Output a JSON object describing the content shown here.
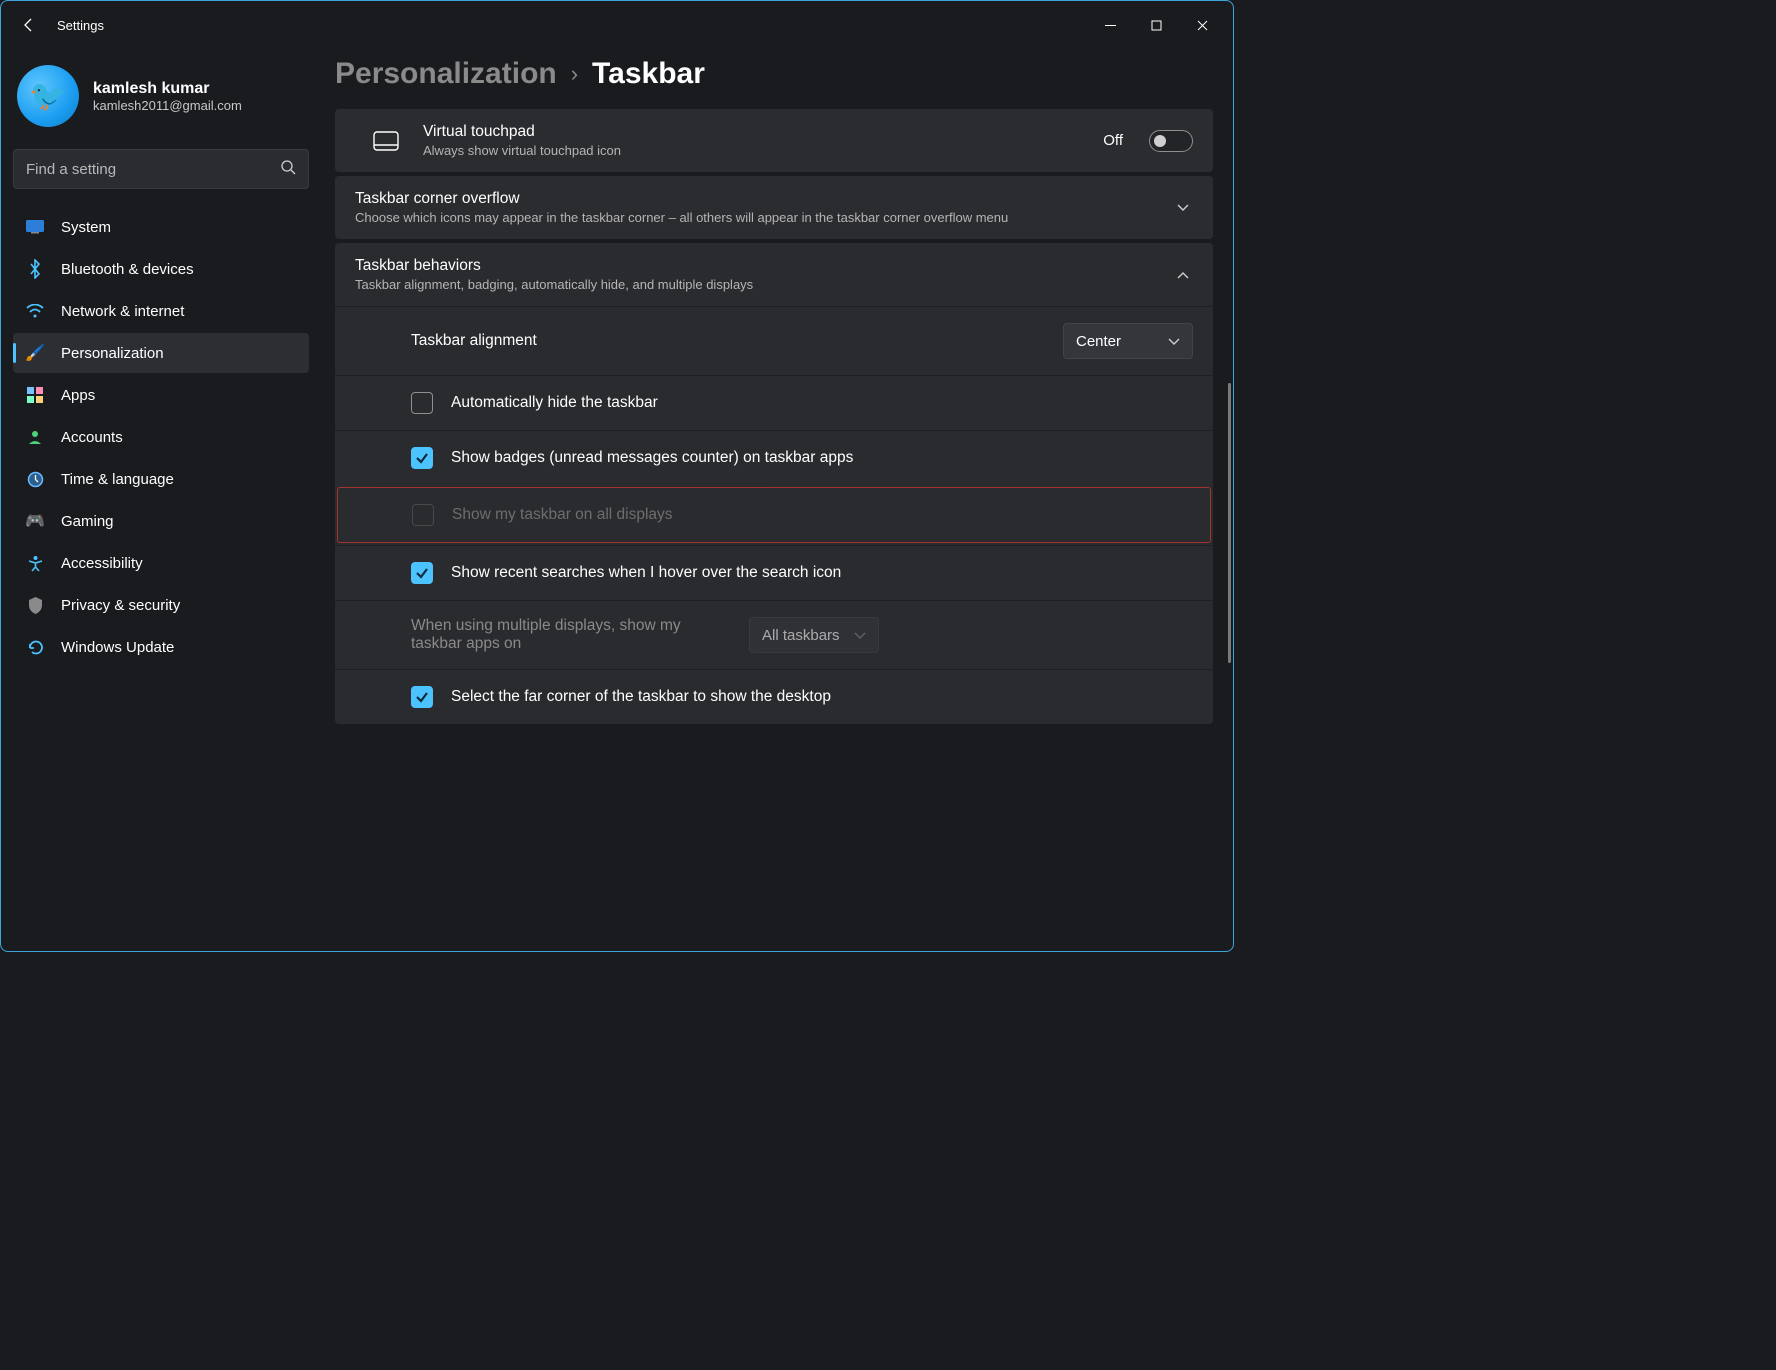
{
  "window": {
    "app_title": "Settings"
  },
  "user": {
    "name": "kamlesh kumar",
    "email": "kamlesh2011@gmail.com"
  },
  "search": {
    "placeholder": "Find a setting"
  },
  "nav": {
    "items": [
      {
        "label": "System"
      },
      {
        "label": "Bluetooth & devices"
      },
      {
        "label": "Network & internet"
      },
      {
        "label": "Personalization"
      },
      {
        "label": "Apps"
      },
      {
        "label": "Accounts"
      },
      {
        "label": "Time & language"
      },
      {
        "label": "Gaming"
      },
      {
        "label": "Accessibility"
      },
      {
        "label": "Privacy & security"
      },
      {
        "label": "Windows Update"
      }
    ]
  },
  "breadcrumb": {
    "parent": "Personalization",
    "current": "Taskbar"
  },
  "virtual_touchpad": {
    "title": "Virtual touchpad",
    "sub": "Always show virtual touchpad icon",
    "state_label": "Off"
  },
  "overflow": {
    "title": "Taskbar corner overflow",
    "sub": "Choose which icons may appear in the taskbar corner – all others will appear in the taskbar corner overflow menu"
  },
  "behaviors": {
    "title": "Taskbar behaviors",
    "sub": "Taskbar alignment, badging, automatically hide, and multiple displays",
    "alignment_label": "Taskbar alignment",
    "alignment_value": "Center",
    "opt_autohide": "Automatically hide the taskbar",
    "opt_badges": "Show badges (unread messages counter) on taskbar apps",
    "opt_all_displays": "Show my taskbar on all displays",
    "opt_recent_searches": "Show recent searches when I hover over the search icon",
    "multi_displays_label": "When using multiple displays, show my taskbar apps on",
    "multi_displays_value": "All taskbars",
    "opt_far_corner": "Select the far corner of the taskbar to show the desktop"
  }
}
